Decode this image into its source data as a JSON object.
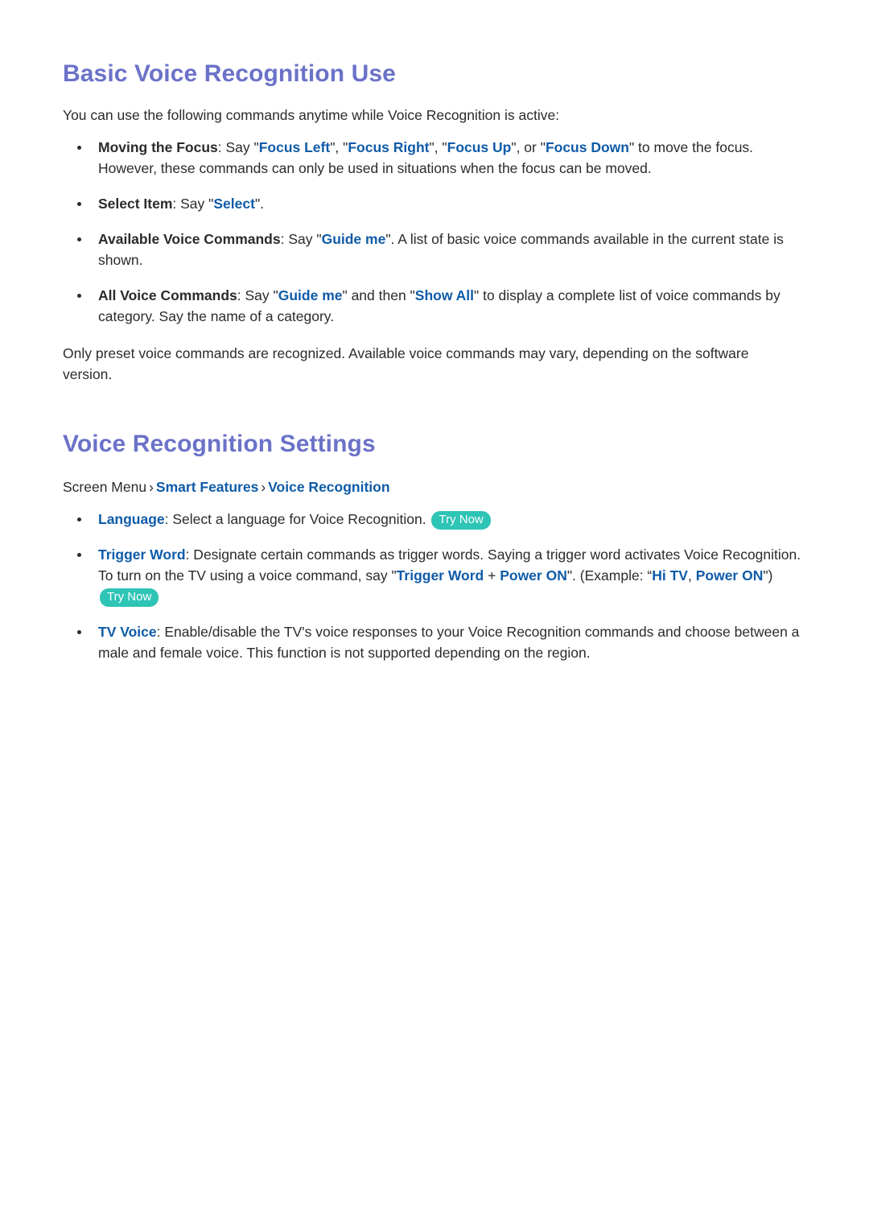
{
  "page": {
    "background": "#ffffff",
    "heading_color": "#6b72c8",
    "link_color": "#0f5ba8",
    "badge_color": "#2ec4b6",
    "text_color": "#2b2b2b"
  },
  "section1": {
    "heading": "Basic Voice Recognition Use",
    "intro": "You can use the following commands anytime while Voice Recognition is active:",
    "bullets": [
      {
        "label": "Moving the Focus",
        "label_sep": ": Say \"",
        "commands": [
          "Focus Left",
          "Focus Right",
          "Focus Up",
          "Focus Down"
        ],
        "sep_1": "\", \"",
        "sep_2": "\", \"",
        "sep_3": "\", or \"",
        "tail": "\" to move the focus. However, these commands can only be used in situations when the focus can be moved."
      },
      {
        "label": "Select Item",
        "label_sep": ": Say \"",
        "command": "Select",
        "tail": "\"."
      },
      {
        "label": "Available Voice Commands",
        "label_sep": ": Say \"",
        "command": "Guide me",
        "tail": "\". A list of basic voice commands available in the current state is shown."
      },
      {
        "label": "All Voice Commands",
        "label_sep": ": Say \"",
        "command_1": "Guide me",
        "mid": "\" and then \"",
        "command_2": "Show All",
        "tail": "\" to display a complete list of voice commands by category. Say the name of a category."
      }
    ],
    "note": "Only preset voice commands are recognized. Available voice commands may vary, depending on the software version."
  },
  "section2": {
    "heading": "Voice Recognition Settings",
    "breadcrumb": {
      "root": "Screen Menu",
      "separator": "›",
      "items": [
        "Smart Features",
        "Voice Recognition"
      ]
    },
    "bullets": [
      {
        "label": "Language",
        "text": ": Select a language for Voice Recognition.",
        "badge": "Try Now"
      },
      {
        "label": "Trigger Word",
        "text_1": ": Designate certain commands as trigger words. Saying a trigger word activates Voice Recognition. To turn on the TV using a voice command, say \"",
        "cmd_1": "Trigger Word",
        "plus": " + ",
        "cmd_2": "Power ON",
        "text_2": "\". (Example: “",
        "cmd_3": "Hi TV",
        "comma": ", ",
        "cmd_4": "Power ON",
        "text_3": "\")",
        "badge": "Try Now"
      },
      {
        "label": "TV Voice",
        "text": ": Enable/disable the TV's voice responses to your Voice Recognition commands and choose between a male and female voice. This function is not supported depending on the region."
      }
    ]
  }
}
